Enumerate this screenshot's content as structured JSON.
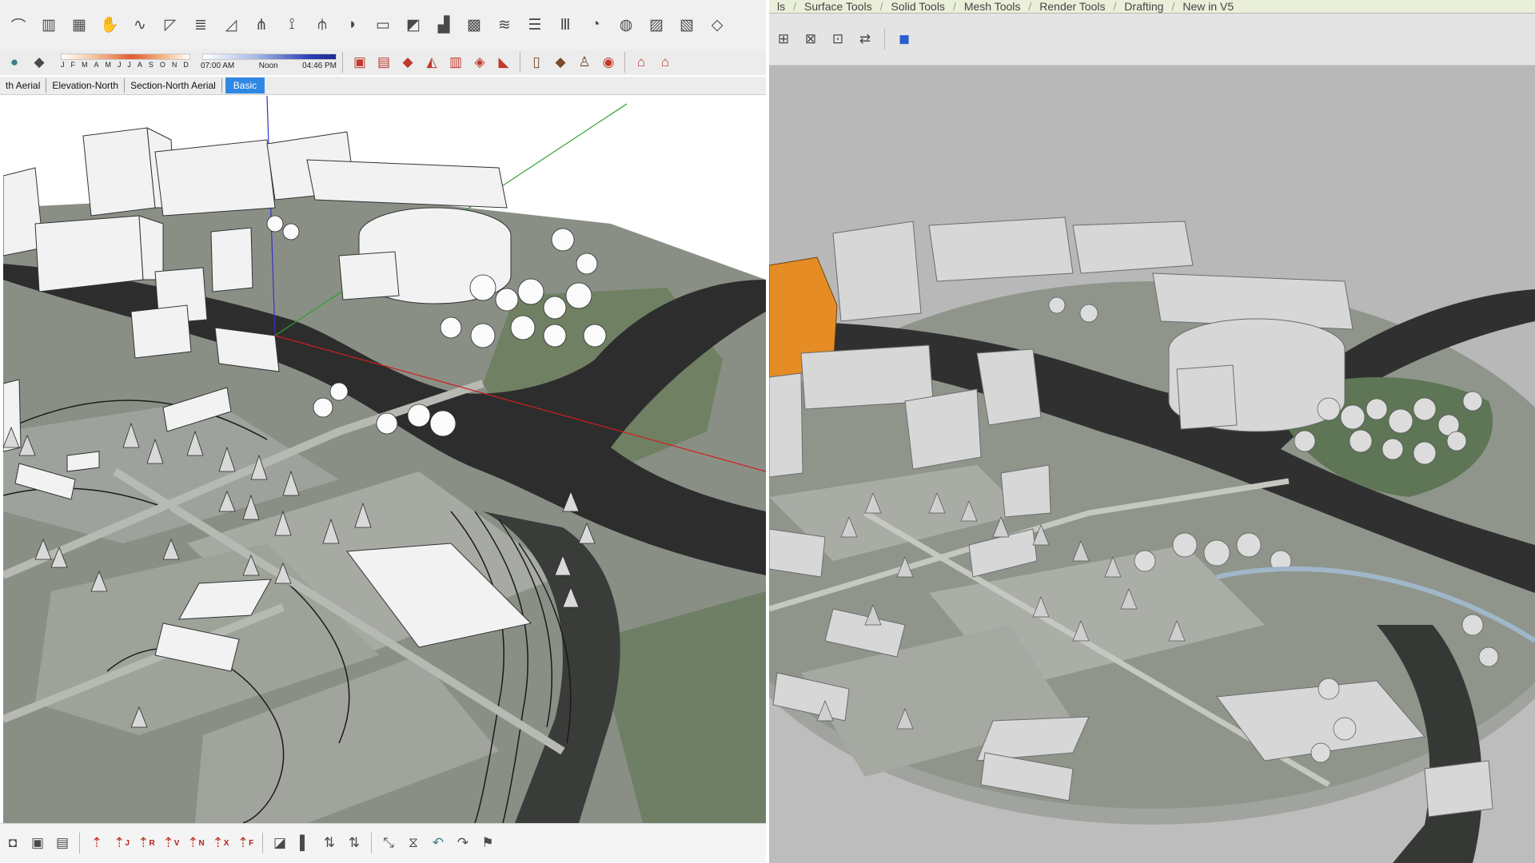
{
  "left_app": {
    "toolbar_top": {
      "icons": [
        "arc-icon",
        "column-icon",
        "grid-icon",
        "hand-icon",
        "curve-icon",
        "fold-icon",
        "stack-icon",
        "slope-icon",
        "branch-icon",
        "tree-icon",
        "fork-icon",
        "shell-icon",
        "box-tool-icon",
        "extrude-icon",
        "stair-icon",
        "mesh-icon",
        "wave-icon",
        "lines-icon",
        "rail-icon",
        "dome-icon",
        "sphere-icon",
        "hatch-icon",
        "pattern-icon",
        "wire-box-icon"
      ]
    },
    "toolbar_second": {
      "shadow_months": [
        "J",
        "F",
        "M",
        "A",
        "M",
        "J",
        "J",
        "A",
        "S",
        "O",
        "N",
        "D"
      ],
      "time_labels": {
        "start": "07:00 AM",
        "mid": "Noon",
        "end": "04:46 PM"
      },
      "right_icons": [
        "book-icon",
        "map-icon",
        "model-icon",
        "terrain-icon",
        "stamp-icon",
        "drape-icon",
        "flip-icon",
        "book-open-icon",
        "layer-icon",
        "figure-icon",
        "globe-icon",
        "warehouse-icon",
        "building-icon"
      ]
    },
    "scene_tabs": [
      {
        "label": "th Aerial",
        "active": false
      },
      {
        "label": "Elevation-North",
        "active": false
      },
      {
        "label": "Section-North Aerial",
        "active": false
      },
      {
        "label": "Basic",
        "active": true
      }
    ],
    "bottom_toolbar": {
      "icons": [
        "cube-icon",
        "box-icon",
        "boxes-icon",
        "red-arrow-icon",
        "j-arrow-icon",
        "ar-arrow-icon",
        "av-arrow-icon",
        "an-arrow-icon",
        "ax-arrow-icon",
        "af-arrow-icon",
        "color-icon",
        "section-icon",
        "flip-up-icon",
        "swap-icon",
        "diagonal-icon",
        "hourglass-icon",
        "undo-blue-icon",
        "undo-red-icon",
        "flag-icon"
      ],
      "labels": [
        "J",
        "R",
        "V",
        "N",
        "X",
        "F"
      ]
    }
  },
  "right_app": {
    "ribbon_tabs": [
      "ls",
      "Surface Tools",
      "Solid Tools",
      "Mesh Tools",
      "Render Tools",
      "Drafting",
      "New in V5"
    ],
    "tool_icons": [
      "grid-arrow-icon",
      "grid-select-icon",
      "grid-move-icon",
      "grid-arrows-icon",
      "blue-cube-icon"
    ]
  },
  "colors": {
    "accent": "#2f88e3",
    "river": "#2b2b2b",
    "terrain": "#7f8d78",
    "building": "#f2f2f2"
  }
}
